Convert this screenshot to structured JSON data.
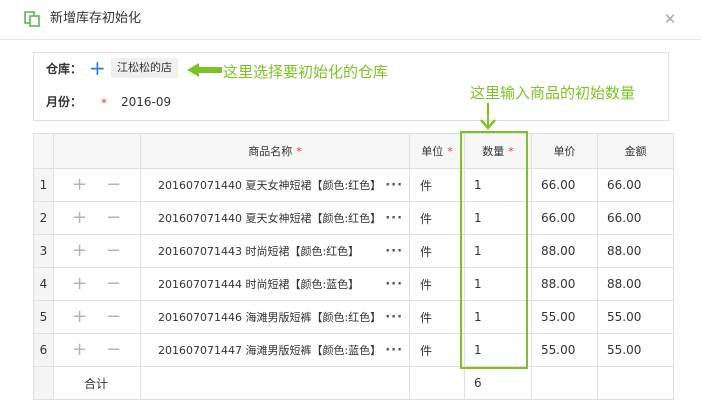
{
  "dialog": {
    "title": "新增库存初始化",
    "icon": "copy-icon",
    "close_icon": "close-icon"
  },
  "form": {
    "warehouse_label": "仓库：",
    "warehouse_value": "江松松的店",
    "month_label": "月份：",
    "month_value": "2016-09",
    "required_mark": "*"
  },
  "annotations": {
    "warehouse_hint": "这里选择要初始化的仓库",
    "quantity_hint": "这里输入商品的初始数量",
    "accent_color": "#7ec326"
  },
  "table": {
    "headers": {
      "name": "商品名称",
      "unit": "单位",
      "qty": "数量",
      "price": "单价",
      "amount": "金额"
    },
    "required_mark": "*",
    "add_icon": "plus-icon",
    "remove_icon": "minus-icon",
    "more_label": "···",
    "rows": [
      {
        "idx": "1",
        "name": "201607071440 夏天女神短裙【颜色:红色】",
        "unit": "件",
        "qty": "1",
        "price": "66.00",
        "amount": "66.00"
      },
      {
        "idx": "2",
        "name": "201607071440 夏天女神短裙【颜色:红色】",
        "unit": "件",
        "qty": "1",
        "price": "66.00",
        "amount": "66.00"
      },
      {
        "idx": "3",
        "name": "201607071443 时尚短裙【颜色:红色】",
        "unit": "件",
        "qty": "1",
        "price": "88.00",
        "amount": "88.00"
      },
      {
        "idx": "4",
        "name": "201607071444 时尚短裙【颜色:蓝色】",
        "unit": "件",
        "qty": "1",
        "price": "88.00",
        "amount": "88.00"
      },
      {
        "idx": "5",
        "name": "201607071446 海滩男版短裤【颜色:红色】",
        "unit": "件",
        "qty": "1",
        "price": "55.00",
        "amount": "55.00"
      },
      {
        "idx": "6",
        "name": "201607071447 海滩男版短裤【颜色:蓝色】",
        "unit": "件",
        "qty": "1",
        "price": "55.00",
        "amount": "55.00"
      }
    ],
    "total": {
      "label": "合计",
      "qty": "6"
    }
  }
}
